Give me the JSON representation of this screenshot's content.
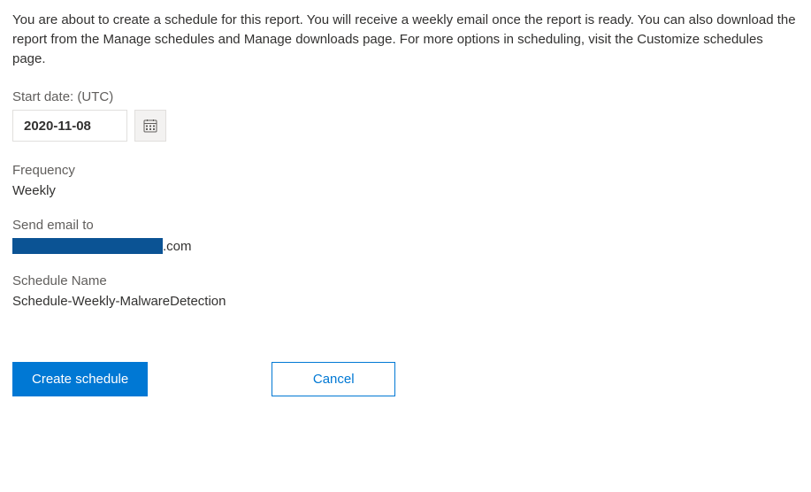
{
  "intro": "You are about to create a schedule for this report. You will receive a weekly email once the report is ready. You can also download the report from the Manage schedules and Manage downloads page. For more options in scheduling, visit the Customize schedules page.",
  "startDate": {
    "label": "Start date: (UTC)",
    "value": "2020-11-08"
  },
  "frequency": {
    "label": "Frequency",
    "value": "Weekly"
  },
  "sendEmail": {
    "label": "Send email to",
    "suffix": ".com"
  },
  "scheduleName": {
    "label": "Schedule Name",
    "value": "Schedule-Weekly-MalwareDetection"
  },
  "buttons": {
    "create": "Create schedule",
    "cancel": "Cancel"
  }
}
